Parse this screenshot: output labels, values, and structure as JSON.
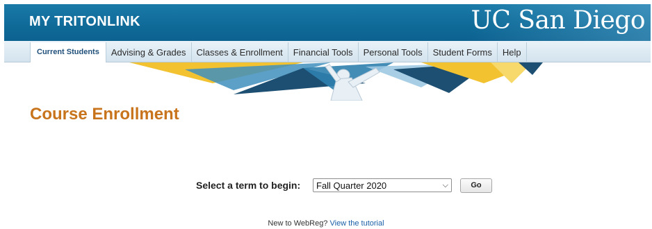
{
  "header": {
    "app_title": "MY TRITONLINK",
    "logo_text": "UC San Diego"
  },
  "nav": {
    "items": [
      {
        "label": "Current Students",
        "active": true
      },
      {
        "label": "Advising & Grades"
      },
      {
        "label": "Classes & Enrollment"
      },
      {
        "label": "Financial Tools"
      },
      {
        "label": "Personal Tools"
      },
      {
        "label": "Student Forms"
      },
      {
        "label": "Help"
      }
    ]
  },
  "main": {
    "title": "Course Enrollment",
    "term_prompt": "Select a term to begin:",
    "term_selected": "Fall Quarter 2020",
    "go_label": "Go",
    "tutorial_prefix": "New to WebReg? ",
    "tutorial_link": "View the tutorial"
  },
  "colors": {
    "header_blue": "#0f6a98",
    "nav_bg": "#dde9f1",
    "title_orange": "#c8741c",
    "link_blue": "#1a5fa8",
    "banner_gold": "#f2c230",
    "banner_navy": "#1c4f72"
  },
  "icons": {
    "select_arrow": "chevron-down-icon"
  }
}
